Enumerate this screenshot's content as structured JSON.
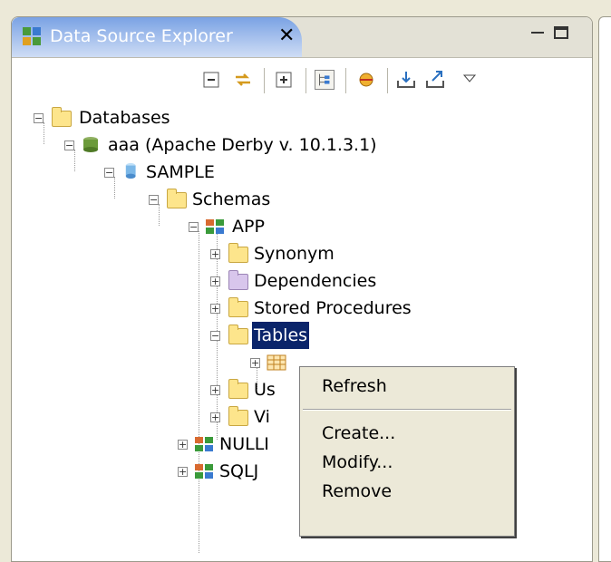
{
  "view": {
    "title": "Data Source Explorer",
    "close_symbol": "✕",
    "toolbar_icons": [
      "collapse-all-icon",
      "link-with-editor-icon",
      "expand-icon",
      "show-hierarchy-icon",
      "connect-icon",
      "import-icon",
      "export-icon",
      "view-menu-icon"
    ]
  },
  "tree": {
    "databases": "Databases",
    "connection": "aaa (Apache Derby v. 10.1.3.1)",
    "database": "SAMPLE",
    "schemas": "Schemas",
    "app": "APP",
    "synonym": "Synonym",
    "dependencies": "Dependencies",
    "stored_procedures": "Stored Procedures",
    "tables": "Tables",
    "us_partial": "Us",
    "vi_partial": "Vi",
    "nulli_partial": "NULLI",
    "sqlj": "SQLJ"
  },
  "context_menu": {
    "refresh": "Refresh",
    "create": "Create...",
    "modify": "Modify...",
    "remove": "Remove"
  },
  "colors": {
    "selection": "#0a246a",
    "tab_gradient_top": "#7aa2e4",
    "menu_bg": "#ece9d8"
  }
}
